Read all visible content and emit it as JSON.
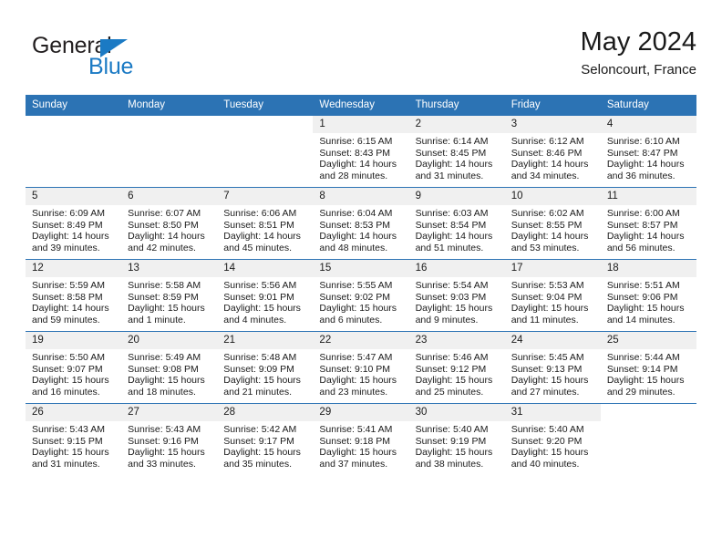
{
  "brand": {
    "name_part1": "General",
    "name_part2": "Blue",
    "triangle_color": "#1b7ac4"
  },
  "header": {
    "month_title": "May 2024",
    "location": "Seloncourt, France"
  },
  "theme": {
    "header_blue": "#2c73b4",
    "band_gray": "#f0f0f0",
    "text": "#1a1a1a"
  },
  "weekday_headers": [
    "Sunday",
    "Monday",
    "Tuesday",
    "Wednesday",
    "Thursday",
    "Friday",
    "Saturday"
  ],
  "weeks": [
    [
      {
        "day": "",
        "blank": true
      },
      {
        "day": "",
        "blank": true
      },
      {
        "day": "",
        "blank": true
      },
      {
        "day": "1",
        "sunrise": "Sunrise: 6:15 AM",
        "sunset": "Sunset: 8:43 PM",
        "daylight": "Daylight: 14 hours and 28 minutes."
      },
      {
        "day": "2",
        "sunrise": "Sunrise: 6:14 AM",
        "sunset": "Sunset: 8:45 PM",
        "daylight": "Daylight: 14 hours and 31 minutes."
      },
      {
        "day": "3",
        "sunrise": "Sunrise: 6:12 AM",
        "sunset": "Sunset: 8:46 PM",
        "daylight": "Daylight: 14 hours and 34 minutes."
      },
      {
        "day": "4",
        "sunrise": "Sunrise: 6:10 AM",
        "sunset": "Sunset: 8:47 PM",
        "daylight": "Daylight: 14 hours and 36 minutes."
      }
    ],
    [
      {
        "day": "5",
        "sunrise": "Sunrise: 6:09 AM",
        "sunset": "Sunset: 8:49 PM",
        "daylight": "Daylight: 14 hours and 39 minutes."
      },
      {
        "day": "6",
        "sunrise": "Sunrise: 6:07 AM",
        "sunset": "Sunset: 8:50 PM",
        "daylight": "Daylight: 14 hours and 42 minutes."
      },
      {
        "day": "7",
        "sunrise": "Sunrise: 6:06 AM",
        "sunset": "Sunset: 8:51 PM",
        "daylight": "Daylight: 14 hours and 45 minutes."
      },
      {
        "day": "8",
        "sunrise": "Sunrise: 6:04 AM",
        "sunset": "Sunset: 8:53 PM",
        "daylight": "Daylight: 14 hours and 48 minutes."
      },
      {
        "day": "9",
        "sunrise": "Sunrise: 6:03 AM",
        "sunset": "Sunset: 8:54 PM",
        "daylight": "Daylight: 14 hours and 51 minutes."
      },
      {
        "day": "10",
        "sunrise": "Sunrise: 6:02 AM",
        "sunset": "Sunset: 8:55 PM",
        "daylight": "Daylight: 14 hours and 53 minutes."
      },
      {
        "day": "11",
        "sunrise": "Sunrise: 6:00 AM",
        "sunset": "Sunset: 8:57 PM",
        "daylight": "Daylight: 14 hours and 56 minutes."
      }
    ],
    [
      {
        "day": "12",
        "sunrise": "Sunrise: 5:59 AM",
        "sunset": "Sunset: 8:58 PM",
        "daylight": "Daylight: 14 hours and 59 minutes."
      },
      {
        "day": "13",
        "sunrise": "Sunrise: 5:58 AM",
        "sunset": "Sunset: 8:59 PM",
        "daylight": "Daylight: 15 hours and 1 minute."
      },
      {
        "day": "14",
        "sunrise": "Sunrise: 5:56 AM",
        "sunset": "Sunset: 9:01 PM",
        "daylight": "Daylight: 15 hours and 4 minutes."
      },
      {
        "day": "15",
        "sunrise": "Sunrise: 5:55 AM",
        "sunset": "Sunset: 9:02 PM",
        "daylight": "Daylight: 15 hours and 6 minutes."
      },
      {
        "day": "16",
        "sunrise": "Sunrise: 5:54 AM",
        "sunset": "Sunset: 9:03 PM",
        "daylight": "Daylight: 15 hours and 9 minutes."
      },
      {
        "day": "17",
        "sunrise": "Sunrise: 5:53 AM",
        "sunset": "Sunset: 9:04 PM",
        "daylight": "Daylight: 15 hours and 11 minutes."
      },
      {
        "day": "18",
        "sunrise": "Sunrise: 5:51 AM",
        "sunset": "Sunset: 9:06 PM",
        "daylight": "Daylight: 15 hours and 14 minutes."
      }
    ],
    [
      {
        "day": "19",
        "sunrise": "Sunrise: 5:50 AM",
        "sunset": "Sunset: 9:07 PM",
        "daylight": "Daylight: 15 hours and 16 minutes."
      },
      {
        "day": "20",
        "sunrise": "Sunrise: 5:49 AM",
        "sunset": "Sunset: 9:08 PM",
        "daylight": "Daylight: 15 hours and 18 minutes."
      },
      {
        "day": "21",
        "sunrise": "Sunrise: 5:48 AM",
        "sunset": "Sunset: 9:09 PM",
        "daylight": "Daylight: 15 hours and 21 minutes."
      },
      {
        "day": "22",
        "sunrise": "Sunrise: 5:47 AM",
        "sunset": "Sunset: 9:10 PM",
        "daylight": "Daylight: 15 hours and 23 minutes."
      },
      {
        "day": "23",
        "sunrise": "Sunrise: 5:46 AM",
        "sunset": "Sunset: 9:12 PM",
        "daylight": "Daylight: 15 hours and 25 minutes."
      },
      {
        "day": "24",
        "sunrise": "Sunrise: 5:45 AM",
        "sunset": "Sunset: 9:13 PM",
        "daylight": "Daylight: 15 hours and 27 minutes."
      },
      {
        "day": "25",
        "sunrise": "Sunrise: 5:44 AM",
        "sunset": "Sunset: 9:14 PM",
        "daylight": "Daylight: 15 hours and 29 minutes."
      }
    ],
    [
      {
        "day": "26",
        "sunrise": "Sunrise: 5:43 AM",
        "sunset": "Sunset: 9:15 PM",
        "daylight": "Daylight: 15 hours and 31 minutes."
      },
      {
        "day": "27",
        "sunrise": "Sunrise: 5:43 AM",
        "sunset": "Sunset: 9:16 PM",
        "daylight": "Daylight: 15 hours and 33 minutes."
      },
      {
        "day": "28",
        "sunrise": "Sunrise: 5:42 AM",
        "sunset": "Sunset: 9:17 PM",
        "daylight": "Daylight: 15 hours and 35 minutes."
      },
      {
        "day": "29",
        "sunrise": "Sunrise: 5:41 AM",
        "sunset": "Sunset: 9:18 PM",
        "daylight": "Daylight: 15 hours and 37 minutes."
      },
      {
        "day": "30",
        "sunrise": "Sunrise: 5:40 AM",
        "sunset": "Sunset: 9:19 PM",
        "daylight": "Daylight: 15 hours and 38 minutes."
      },
      {
        "day": "31",
        "sunrise": "Sunrise: 5:40 AM",
        "sunset": "Sunset: 9:20 PM",
        "daylight": "Daylight: 15 hours and 40 minutes."
      },
      {
        "day": "",
        "blank": true
      }
    ]
  ]
}
